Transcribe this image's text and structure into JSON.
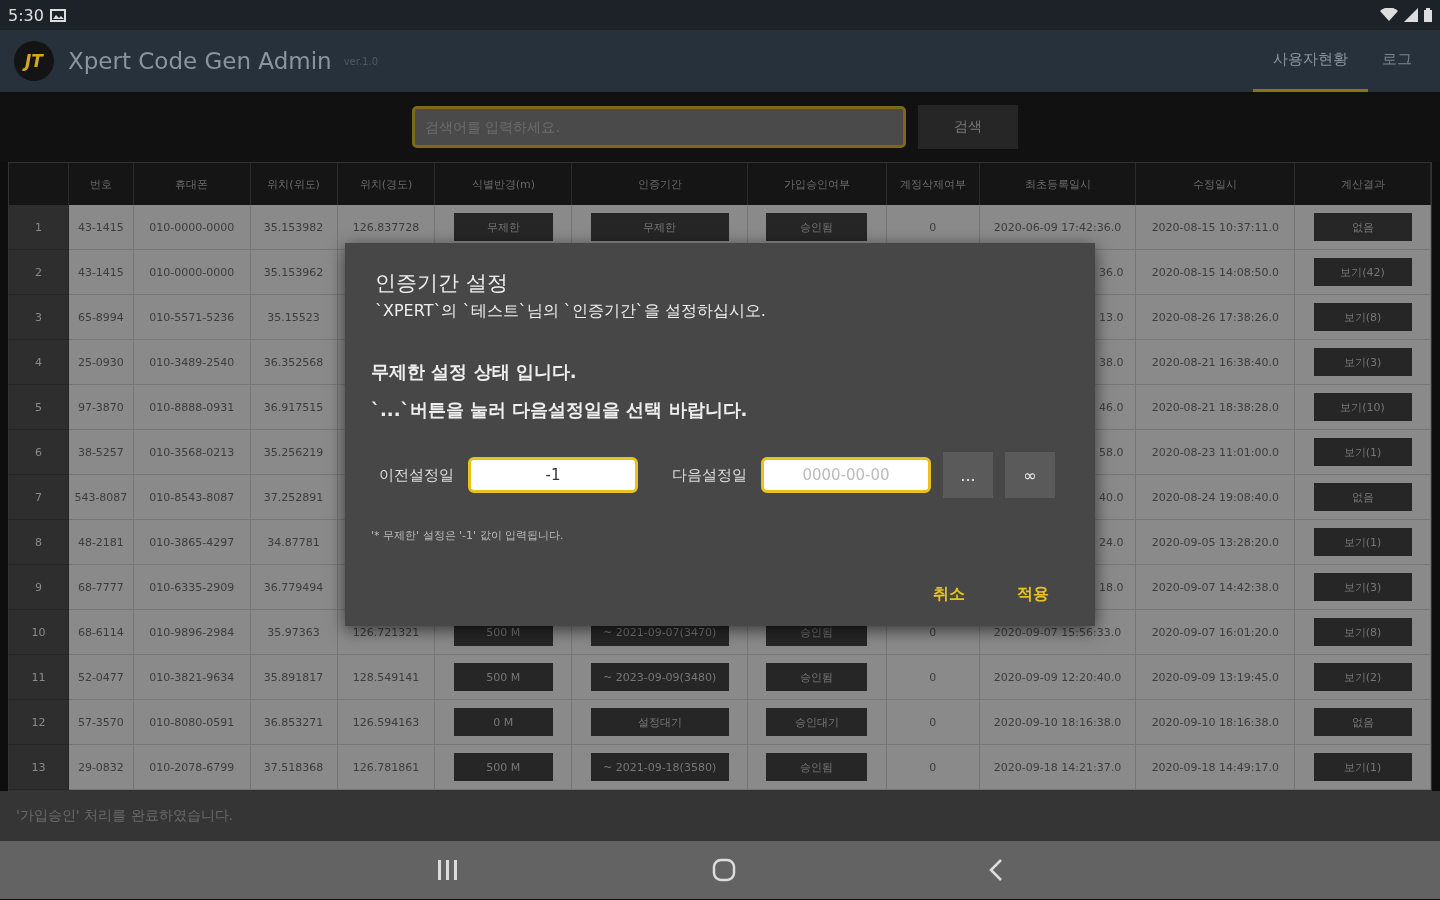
{
  "status_bar": {
    "time": "5:30"
  },
  "app_bar": {
    "logo": "JT",
    "title": "Xpert Code Gen Admin",
    "version": "ver.1.0",
    "tabs": [
      {
        "label": "사용자현황",
        "selected": true
      },
      {
        "label": "로그",
        "selected": false
      }
    ]
  },
  "search": {
    "placeholder": "검색어를 입력하세요.",
    "button": "검색"
  },
  "table": {
    "columns": [
      {
        "kind": "index"
      },
      {
        "label": "번호",
        "kind": "text"
      },
      {
        "label": "휴대폰",
        "kind": "text"
      },
      {
        "label": "위치(위도)",
        "kind": "text"
      },
      {
        "label": "위치(경도)",
        "kind": "text"
      },
      {
        "label": "식별반경(m)",
        "kind": "button"
      },
      {
        "label": "인증기간",
        "kind": "button"
      },
      {
        "label": "가입승인여부",
        "kind": "button"
      },
      {
        "label": "계정삭제여부",
        "kind": "text"
      },
      {
        "label": "최초등록일시",
        "kind": "text"
      },
      {
        "label": "수정일시",
        "kind": "text"
      },
      {
        "label": "계산결과",
        "kind": "button"
      }
    ],
    "rows": [
      {
        "kind": "full",
        "cells": [
          "1",
          "43-1415",
          "010-0000-0000",
          "35.153982",
          "126.837728",
          "무제한",
          "무제한",
          "승인됨",
          "0",
          "2020-06-09 17:42:36.0",
          "2020-08-15 10:37:11.0",
          "없음"
        ]
      },
      {
        "kind": "covered",
        "cells": [
          "2",
          "43-1415",
          "010-0000-0000",
          "35.153962",
          "36.0",
          "2020-08-15 14:08:50.0",
          "보기(42)"
        ]
      },
      {
        "kind": "covered",
        "cells": [
          "3",
          "65-8994",
          "010-5571-5236",
          "35.15523",
          "13.0",
          "2020-08-26 17:38:26.0",
          "보기(8)"
        ]
      },
      {
        "kind": "covered",
        "cells": [
          "4",
          "25-0930",
          "010-3489-2540",
          "36.352568",
          "38.0",
          "2020-08-21 16:38:40.0",
          "보기(3)"
        ]
      },
      {
        "kind": "covered",
        "cells": [
          "5",
          "97-3870",
          "010-8888-0931",
          "36.917515",
          "46.0",
          "2020-08-21 18:38:28.0",
          "보기(10)"
        ]
      },
      {
        "kind": "covered",
        "cells": [
          "6",
          "38-5257",
          "010-3568-0213",
          "35.256219",
          "58.0",
          "2020-08-23 11:01:00.0",
          "보기(1)"
        ]
      },
      {
        "kind": "covered",
        "cells": [
          "7",
          "543-8087",
          "010-8543-8087",
          "37.252891",
          "40.0",
          "2020-08-24 19:08:40.0",
          "없음"
        ]
      },
      {
        "kind": "covered",
        "cells": [
          "8",
          "48-2181",
          "010-3865-4297",
          "34.87781",
          "24.0",
          "2020-09-05 13:28:20.0",
          "보기(1)"
        ]
      },
      {
        "kind": "covered",
        "cells": [
          "9",
          "68-7777",
          "010-6335-2909",
          "36.779494",
          "18.0",
          "2020-09-07 14:42:38.0",
          "보기(3)"
        ]
      },
      {
        "kind": "full",
        "cells": [
          "10",
          "68-6114",
          "010-9896-2984",
          "35.97363",
          "126.721321",
          "500 M",
          "~ 2021-09-07(3470)",
          "승인됨",
          "0",
          "2020-09-07 15:56:33.0",
          "2020-09-07 16:01:20.0",
          "보기(8)"
        ]
      },
      {
        "kind": "full",
        "cells": [
          "11",
          "52-0477",
          "010-3821-9634",
          "35.891817",
          "128.549141",
          "500 M",
          "~ 2023-09-09(3480)",
          "승인됨",
          "0",
          "2020-09-09 12:20:40.0",
          "2020-09-09 13:19:45.0",
          "보기(2)"
        ]
      },
      {
        "kind": "full",
        "cells": [
          "12",
          "57-3570",
          "010-8080-0591",
          "36.853271",
          "126.594163",
          "0 M",
          "설정대기",
          "승인대기",
          "0",
          "2020-09-10 18:16:38.0",
          "2020-09-10 18:16:38.0",
          "없음"
        ]
      },
      {
        "kind": "full",
        "cells": [
          "13",
          "29-0832",
          "010-2078-6799",
          "37.518368",
          "126.781861",
          "500 M",
          "~ 2021-09-18(3580)",
          "승인됨",
          "0",
          "2020-09-18 14:21:37.0",
          "2020-09-18 14:49:17.0",
          "보기(1)"
        ]
      }
    ]
  },
  "dialog": {
    "title": "인증기간 설정",
    "subtitle": "`XPERT`의 `테스트`님의 `인증기간`을 설정하십시오.",
    "messages": [
      "무제한 설정 상태 입니다.",
      "`...`버튼을 눌러 다음설정일을 선택 바랍니다."
    ],
    "previous": {
      "label": "이전설정일",
      "value": "-1"
    },
    "next": {
      "label": "다음설정일",
      "placeholder": "0000-00-00"
    },
    "tool_buttons": [
      "...",
      "∞"
    ],
    "hint": "'* 무제한' 설정은 '-1' 값이 입력됩니다.",
    "actions": [
      "취소",
      "적용"
    ]
  },
  "snackbar": "'가입승인' 처리를 완료하였습니다."
}
